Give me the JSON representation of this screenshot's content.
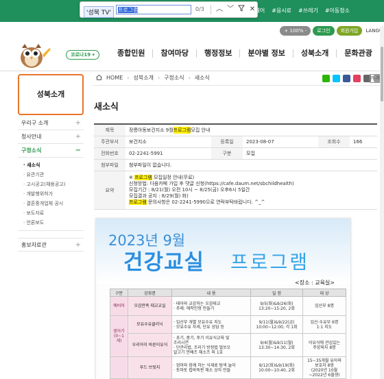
{
  "findbar": {
    "query": "'성북 TV'",
    "input": "프로그램",
    "count": "0/3"
  },
  "top_links": [
    "혜어",
    "#응시료",
    "#쓰레기",
    "#아동청소"
  ],
  "util": {
    "zoom": "+ 100% -",
    "login": "로그인",
    "join": "회원가입",
    "lang": "LANGU"
  },
  "corona_label": "코로나19 ▾",
  "gnb": [
    "종합민원",
    "참여마당",
    "행정정보",
    "분야별 정보",
    "성북소개",
    "문화관광"
  ],
  "sidebar": {
    "title": "성북소개",
    "items": [
      {
        "label": "우리구 소개",
        "sign": "+"
      },
      {
        "label": "청사안내",
        "sign": "+"
      },
      {
        "label": "구정소식",
        "sign": "−"
      }
    ],
    "sub": [
      "새소식",
      "유관기관",
      "고시공고(채용공고)",
      "개발행위허가",
      "결혼중개업체 공시",
      "보도자료",
      "언론보도"
    ],
    "last": {
      "label": "홍보자료관",
      "sign": "+"
    }
  },
  "breadcrumb": {
    "home": "HOME",
    "items": [
      "성북소개",
      "구정소식",
      "새소식"
    ]
  },
  "font_btn": "가-가",
  "page_title": "새소식",
  "detail": {
    "title_label": "제목",
    "title_pre": "정릉아동보건지소 9월 ",
    "title_hl": "프로그램",
    "title_post": " 모집 안내",
    "dept_label": "주관부서",
    "dept": "보건지소",
    "date_label": "등록일",
    "date": "2023-08-07",
    "views_label": "조회수",
    "views": "166",
    "phone_label": "전화번호",
    "phone": "02-2241-5991",
    "type_label": "구분",
    "type": "모집",
    "attach_label": "첨부파일",
    "attach": "첨부파일이 없습니다.",
    "summary_label": "요약",
    "summary_1_pre": "※ ",
    "summary_1_hl": "프로그램",
    "summary_1_post": " 모집일정 안내(무료)",
    "summary_2": "신청방법: 다음카페 가입 후 댓글 신청(https://cafe.daum.net/sbchildhealth)",
    "summary_3": "모집기간 : 8/21(월) 오전 10시 ~ 8/25(금) 오후6시 5일간",
    "summary_4": "모집결과 공지 : 8/29(월) 화)",
    "summary_5_hl": "프로그램",
    "summary_5_post": " 문의사항은 02-2241-5990으로 연락부탁바랍니다. ^_^"
  },
  "poster": {
    "year": "2023년  9월",
    "title1": "건강교실",
    "title2": "프로그램",
    "place": "<장소 : 교육실>",
    "headers": [
      "구분",
      "강좌명",
      "내 용",
      "일 정",
      "대 상"
    ],
    "rows": [
      {
        "cat": "예비마",
        "prog": "오감만족 태교교실",
        "content": "· 태아와 교감하는 오감태교\n· 주제: 애착인형 만들기",
        "schedule": "9/5(화)&9/26(화)\n13:20~15:20, 2회",
        "target": "임산부 8명"
      },
      {
        "cat": "영아기\n(0~1세)",
        "prog": "모유수유클리닉",
        "content": "· 임산부 개별 모유수유 지도\n· 모유수유 자세, 단유 상담 등",
        "schedule": "9/11(월)&9/22(금)\n10:00~12:00, 각 1회",
        "target": "임신·수유부 6명\n1:1 지도"
      },
      {
        "cat": "",
        "prog": "우리아이 바른이유식",
        "content": "· 초기, 중기, 후기 이유식교육 및\n 조리시연\n· 단관리법, 조리기 방정법 벌쏘오\n 알고기 안배츠 체소츠 외 1호",
        "schedule": "9/4(월)&9/11(월)\n13:30~14:30, 2회",
        "target": "이유식에 관심있는\n주양육자 8명"
      },
      {
        "cat": "",
        "prog": "푸드 브릿지",
        "content": "· 엄마와 함께 하는 식재료 탐색 놀이\n· 토마토 컵바둑판 체소 상자 만들",
        "schedule": "9/12(화)&9/19(화)\n10:00~10:40, 2회",
        "target": "15~35개월 유아와\n보호자 8쌍\n(2020년 10월~2022년 6월생)"
      }
    ]
  }
}
